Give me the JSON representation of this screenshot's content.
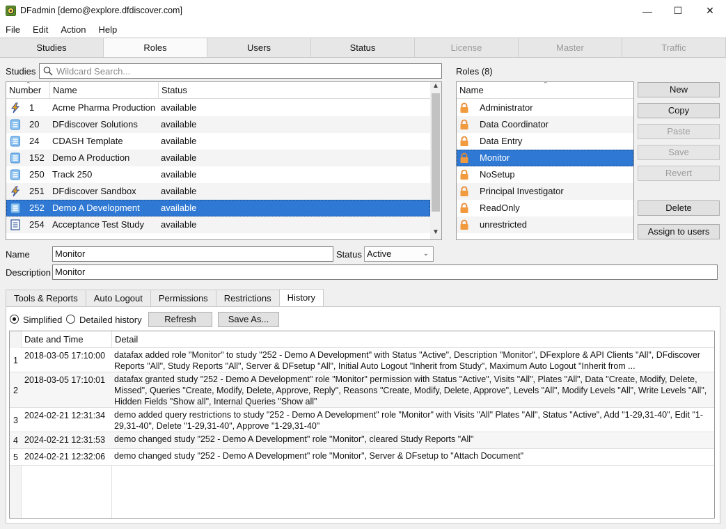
{
  "window": {
    "title": "DFadmin [demo@explore.dfdiscover.com]",
    "minimize": "—",
    "maximize": "☐",
    "close": "✕"
  },
  "menu": [
    "File",
    "Edit",
    "Action",
    "Help"
  ],
  "tabs": [
    {
      "label": "Studies",
      "state": "normal"
    },
    {
      "label": "Roles",
      "state": "active"
    },
    {
      "label": "Users",
      "state": "normal"
    },
    {
      "label": "Status",
      "state": "normal"
    },
    {
      "label": "License",
      "state": "disabled"
    },
    {
      "label": "Master",
      "state": "disabled"
    },
    {
      "label": "Traffic",
      "state": "disabled"
    }
  ],
  "studies": {
    "label": "Studies",
    "search_placeholder": "Wildcard Search...",
    "columns": [
      "Number",
      "Name",
      "Status"
    ],
    "rows": [
      {
        "icon": "lightning-icon",
        "number": "1",
        "name": "Acme Pharma Production",
        "status": "available"
      },
      {
        "icon": "db-icon",
        "number": "20",
        "name": "DFdiscover Solutions",
        "status": "available"
      },
      {
        "icon": "db-icon",
        "number": "24",
        "name": "CDASH Template",
        "status": "available"
      },
      {
        "icon": "db-icon",
        "number": "152",
        "name": "Demo A Production",
        "status": "available"
      },
      {
        "icon": "db-icon",
        "number": "250",
        "name": "Track 250",
        "status": "available"
      },
      {
        "icon": "lightning-icon",
        "number": "251",
        "name": "DFdiscover Sandbox",
        "status": "available"
      },
      {
        "icon": "db-icon",
        "number": "252",
        "name": "Demo A Development",
        "status": "available",
        "selected": true
      },
      {
        "icon": "doc-icon",
        "number": "254",
        "name": "Acceptance Test Study",
        "status": "available"
      }
    ]
  },
  "roles": {
    "label": "Roles (8)",
    "column": "Name",
    "items": [
      "Administrator",
      "Data Coordinator",
      "Data Entry",
      "Monitor",
      "NoSetup",
      "Principal Investigator",
      "ReadOnly",
      "unrestricted"
    ],
    "selected": "Monitor"
  },
  "buttons": {
    "new": "New",
    "copy": "Copy",
    "paste": "Paste",
    "save": "Save",
    "revert": "Revert",
    "delete": "Delete",
    "assign": "Assign to users"
  },
  "form": {
    "name_label": "Name",
    "name_value": "Monitor",
    "status_label": "Status",
    "status_value": "Active",
    "description_label": "Description",
    "description_value": "Monitor"
  },
  "subtabs": [
    "Tools & Reports",
    "Auto Logout",
    "Permissions",
    "Restrictions",
    "History"
  ],
  "history": {
    "simplified_label": "Simplified",
    "detailed_label": "Detailed history",
    "mode": "simplified",
    "refresh": "Refresh",
    "save_as": "Save As...",
    "columns": [
      "Date and Time",
      "Detail"
    ],
    "rows": [
      {
        "n": "1",
        "date": "2018-03-05 17:10:00",
        "detail": "datafax added role \"Monitor\" to study \"252 - Demo A Development\" with Status \"Active\", Description \"Monitor\", DFexplore & API Clients \"All\", DFdiscover Reports \"All\", Study Reports \"All\", Server & DFsetup \"All\", Initial Auto Logout \"Inherit from Study\", Maximum Auto Logout \"Inherit from ..."
      },
      {
        "n": "2",
        "date": "2018-03-05 17:10:01",
        "detail": "datafax granted study \"252 - Demo A Development\" role \"Monitor\" permission with Status \"Active\", Visits \"All\", Plates \"All\", Data \"Create, Modify, Delete, Missed\", Queries \"Create, Modify, Delete, Approve, Reply\", Reasons \"Create, Modify, Delete, Approve\", Levels \"All\", Modify Levels \"All\", Write Levels \"All\", Hidden Fields \"Show all\", Internal Queries \"Show all\""
      },
      {
        "n": "3",
        "date": "2024-02-21 12:31:34",
        "detail": "demo added query restrictions to study \"252 - Demo A Development\" role \"Monitor\" with Visits \"All\" Plates \"All\", Status \"Active\", Add \"1-29,31-40\", Edit \"1-29,31-40\", Delete \"1-29,31-40\", Approve \"1-29,31-40\""
      },
      {
        "n": "4",
        "date": "2024-02-21 12:31:53",
        "detail": "demo changed study \"252 - Demo A Development\" role \"Monitor\", cleared Study Reports \"All\""
      },
      {
        "n": "5",
        "date": "2024-02-21 12:32:06",
        "detail": "demo changed study \"252 - Demo A Development\" role \"Monitor\", Server & DFsetup to \"Attach Document\""
      }
    ]
  }
}
